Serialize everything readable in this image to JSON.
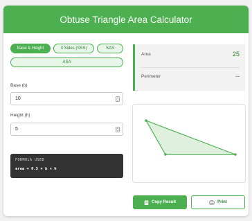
{
  "header": {
    "title": "Obtuse Triangle Area Calculator"
  },
  "modes": {
    "base_height": "Base & Height",
    "three_sides": "3 Sides (SSS)",
    "sas": "SAS",
    "asa": "ASA"
  },
  "inputs": {
    "base_label": "Base (b)",
    "base_value": "10",
    "height_label": "Height (h)",
    "height_value": "5"
  },
  "formula": {
    "title": "FORMULA USED",
    "text": "area = 0.5 × b × h"
  },
  "results": {
    "area_label": "Area",
    "area_value": "25",
    "perimeter_label": "Perimeter",
    "perimeter_value": "--"
  },
  "actions": {
    "copy_label": "Copy Result",
    "print_label": "Print"
  },
  "colors": {
    "accent": "#4caf50",
    "accent_dark": "#2e7d32",
    "triangle_fill": "#dff0df"
  }
}
